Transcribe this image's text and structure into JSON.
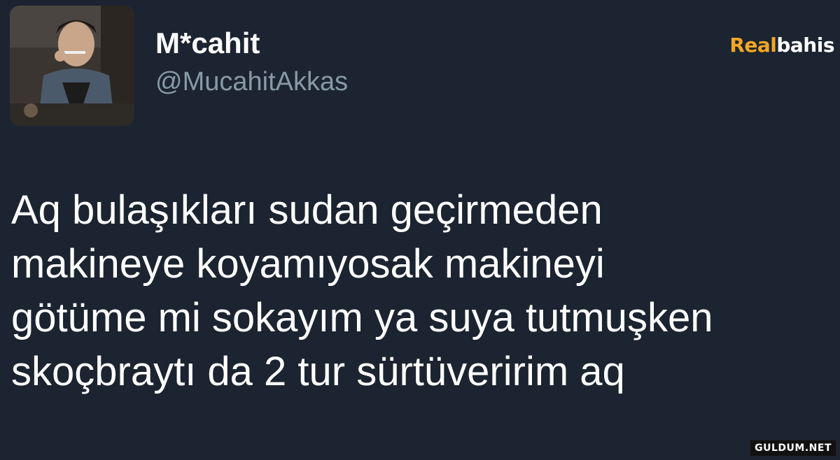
{
  "tweet": {
    "display_name": "M*cahit",
    "handle": "@MucahitAkkas",
    "lines": [
      "Aq bulaşıkları sudan geçirmeden",
      "makineye koyamıyosak makineyi",
      "götüme mi sokayım ya suya tutmuşken",
      "skoçbraytı da 2 tur sürtüveririm aq"
    ]
  },
  "watermarks": {
    "top_a": "Real",
    "top_b": "bahis",
    "bottom": "GULDUM.NET"
  },
  "colors": {
    "background": "#1b2430",
    "handle": "#8899a6",
    "brand_accent": "#f5a623"
  }
}
